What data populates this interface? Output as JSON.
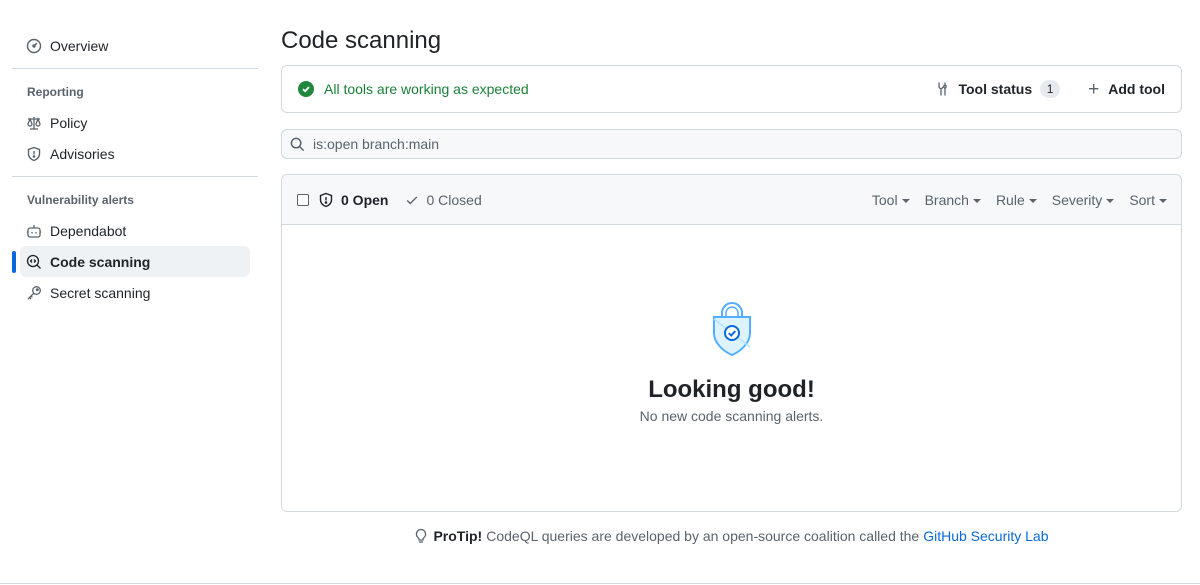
{
  "sidebar": {
    "overview": "Overview",
    "reporting_heading": "Reporting",
    "policy": "Policy",
    "advisories": "Advisories",
    "vuln_heading": "Vulnerability alerts",
    "dependabot": "Dependabot",
    "code_scanning": "Code scanning",
    "secret_scanning": "Secret scanning",
    "accent_color": "#0969da"
  },
  "main": {
    "title": "Code scanning",
    "status_message": "All tools are working as expected",
    "status_color": "#1a7f37",
    "tool_status_label": "Tool status",
    "tool_status_count": "1",
    "add_tool_label": "Add tool",
    "search_value": "is:open branch:main",
    "open_label": "0 Open",
    "closed_label": "0 Closed",
    "filters": {
      "tool": "Tool",
      "branch": "Branch",
      "rule": "Rule",
      "severity": "Severity",
      "sort": "Sort"
    },
    "empty_title": "Looking good!",
    "empty_subtitle": "No new code scanning alerts."
  },
  "protip": {
    "label": "ProTip!",
    "text": "CodeQL queries are developed by an open-source coalition called the",
    "link": "GitHub Security Lab",
    "link_color": "#0969da"
  }
}
